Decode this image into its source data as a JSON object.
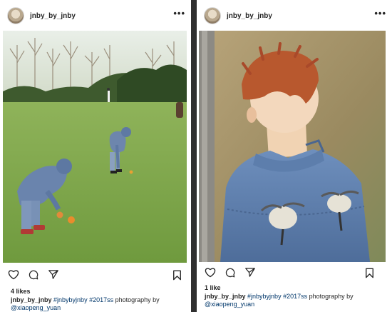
{
  "posts": [
    {
      "username": "jnby_by_jnby",
      "more_label": "•••",
      "likes": "4 likes",
      "caption": {
        "user": "jnby_by_jnby",
        "hashtags": "#jnbybyjnby #2017ss",
        "text": "photography by",
        "mention": "@xiaopeng_yuan"
      }
    },
    {
      "username": "jnby_by_jnby",
      "more_label": "•••",
      "likes": "1 like",
      "caption": {
        "user": "jnby_by_jnby",
        "hashtags": "#jnbybyjnby #2017ss",
        "text": "photography by",
        "mention": "@xiaopeng_yuan"
      }
    }
  ],
  "icons": [
    "heart-icon",
    "comment-icon",
    "share-icon",
    "bookmark-icon",
    "more-icon"
  ],
  "colors": {
    "text": "#262626",
    "link": "#00376b",
    "divider": "#2f2f2f",
    "denim": "#5b7aa6",
    "grass": "#7fa84a"
  }
}
